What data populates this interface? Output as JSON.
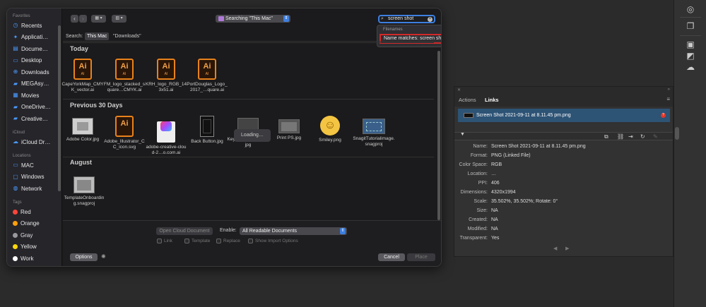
{
  "sidebar": {
    "favorites_header": "Favorites",
    "favorites": [
      {
        "label": "Recents",
        "icon": "clock-icon"
      },
      {
        "label": "Applicati…",
        "icon": "apps-icon"
      },
      {
        "label": "Docume…",
        "icon": "doc-icon"
      },
      {
        "label": "Desktop",
        "icon": "desktop-icon"
      },
      {
        "label": "Downloads",
        "icon": "download-icon"
      },
      {
        "label": "MEGAsy…",
        "icon": "folder-icon"
      },
      {
        "label": "Movies",
        "icon": "film-icon"
      },
      {
        "label": "OneDrive…",
        "icon": "folder-icon"
      },
      {
        "label": "Creative…",
        "icon": "folder-icon"
      }
    ],
    "icloud_header": "iCloud",
    "icloud": [
      {
        "label": "iCloud Dr…",
        "icon": "cloud-icon"
      }
    ],
    "locations_header": "Locations",
    "locations": [
      {
        "label": "MAC",
        "icon": "laptop-icon"
      },
      {
        "label": "Windows",
        "icon": "display-icon"
      },
      {
        "label": "Network",
        "icon": "globe-icon"
      }
    ],
    "tags_header": "Tags",
    "tags": [
      {
        "label": "Red",
        "color": "#ff453a"
      },
      {
        "label": "Orange",
        "color": "#ff9f0a"
      },
      {
        "label": "Gray",
        "color": "#98989d"
      },
      {
        "label": "Yellow",
        "color": "#ffd60a"
      },
      {
        "label": "Work",
        "color": "#ffffff"
      }
    ]
  },
  "toolbar": {
    "back": "‹",
    "forward": "›",
    "view_icon": "▦ ▾",
    "group_icon": "▥ ▾",
    "location": "Searching \"This Mac\"",
    "search_value": "screen shot"
  },
  "suggestions": {
    "header": "Filenames",
    "item": "Name matches: screen shot"
  },
  "scope": {
    "label": "Search:",
    "this_mac": "This Mac",
    "downloads": "\"Downloads\""
  },
  "sections": {
    "today": "Today",
    "prev30": "Previous 30 Days",
    "august": "August"
  },
  "files_today": [
    "CapeYorkMap_CMYK_vector.ai",
    "FM_logo_stacked_square…CMYK.ai",
    "KRH_logo_RGB_143x51.ai",
    "PortDouglas_Logo_2017_…quare.ai"
  ],
  "files_prev30": [
    "Adobe Color.jpg",
    "Adobe_Illustrator_CC_icon.svg",
    "adobe-creative-cloud-2…o.com.ai",
    "Back Button.jpg",
    "Keyboard Shortcuts.jpg",
    "Print PS.jpg",
    "Smiley.png",
    "SnagitTutorialimage.snagproj"
  ],
  "files_august": [
    "TemplateOnboarding.snagproj"
  ],
  "loading": "Loading…",
  "bottom": {
    "open_cloud": "Open Cloud Document",
    "enable_label": "Enable:",
    "enable_value": "All Readable Documents",
    "link": "Link",
    "template": "Template",
    "replace": "Replace",
    "show_import": "Show Import Options",
    "options": "Options",
    "cancel": "Cancel",
    "place": "Place"
  },
  "links_panel": {
    "tab_actions": "Actions",
    "tab_links": "Links",
    "link_name": "Screen Shot 2021-09-11 at 8.11.45 pm.png",
    "info": [
      {
        "k": "Name:",
        "v": "Screen Shot 2021-09-11 at 8.11.45 pm.png"
      },
      {
        "k": "Format:",
        "v": "PNG (Linked File)"
      },
      {
        "k": "Color Space:",
        "v": "RGB"
      },
      {
        "k": "Location:",
        "v": "…"
      },
      {
        "k": "PPI:",
        "v": "406"
      },
      {
        "k": "Dimensions:",
        "v": "4320x1994"
      },
      {
        "k": "Scale:",
        "v": "35.502%, 35.502%; Rotate: 0°"
      },
      {
        "k": "Size:",
        "v": "NA"
      },
      {
        "k": "Created:",
        "v": "NA"
      },
      {
        "k": "Modified:",
        "v": "NA"
      },
      {
        "k": "Transparent:",
        "v": "Yes"
      }
    ]
  },
  "colors": {
    "accent": "#3d7fe0",
    "highlight_border": "#d12a2a",
    "ai_orange": "#e8821c",
    "selected_row": "#2d5375"
  }
}
